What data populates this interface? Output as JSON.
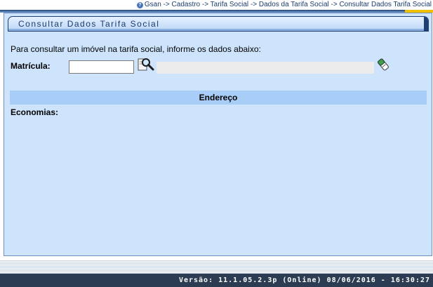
{
  "breadcrumb": {
    "text": "Gsan -> Cadastro -> Tarifa Social -> Dados da Tarifa Social -> Consultar Dados Tarifa Social",
    "help_icon": "help-icon"
  },
  "panel": {
    "title": "Consultar Dados Tarifa Social",
    "instruction": "Para consultar um imóvel na tarifa social, informe os dados abaixo:",
    "matricula_label": "Matrícula:",
    "matricula_value": "",
    "lookup_icon": "magnifier-icon",
    "clear_icon": "eraser-icon",
    "section_header": "Endereço",
    "economias_label": "Economias:"
  },
  "footer": {
    "version": "Versão: 11.1.05.2.3p (Online) 08/06/2016 - 16:30:27"
  },
  "colors": {
    "panel_background": "#cde4fc",
    "section_header_background": "#a8cdf6",
    "footer_background": "#2c3c52",
    "title_text": "#1c3d6e"
  }
}
